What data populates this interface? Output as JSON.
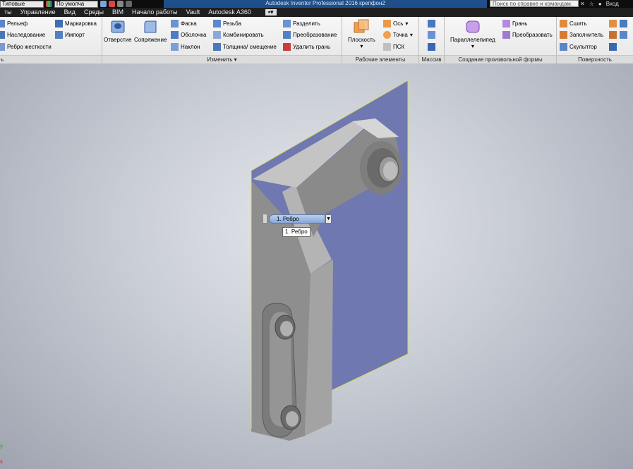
{
  "titlebar": {
    "style_select": "Типовые",
    "material_select": "По умолча",
    "app_title": "Autodesk Inventor Professional 2016    крепфон2",
    "search_placeholder": "Поиск по справке и командам.",
    "signin_label": "Вход"
  },
  "menubar": {
    "items": [
      {
        "label": "ты"
      },
      {
        "label": "Управление"
      },
      {
        "label": "Вид"
      },
      {
        "label": "Среды"
      },
      {
        "label": "BIM"
      },
      {
        "label": "Начало работы"
      },
      {
        "label": "Vault"
      },
      {
        "label": "Autodesk A360"
      }
    ]
  },
  "ribbon": {
    "create": {
      "relief": "Рельеф",
      "derive": "Наследование",
      "rib": "Ребро жесткости",
      "mark": "Маркировка",
      "import": "Импорт",
      "footer": "ь"
    },
    "modify": {
      "hole": "Отверстие",
      "fillet": "Сопряжение",
      "chamfer": "Фаска",
      "shell": "Оболочка",
      "draft": "Наклон",
      "thread": "Резьба",
      "combine": "Комбинировать",
      "thicken": "Толщина/ смещение",
      "split": "Разделить",
      "direct": "Преобразование",
      "delete_face": "Удалить грань",
      "footer": "Изменить ▾"
    },
    "work": {
      "plane": "Плоскость",
      "axis": "Ось",
      "point": "Точка",
      "ucs": "ПСК",
      "footer": "Рабочие элементы"
    },
    "pattern": {
      "footer": "Массив"
    },
    "freeform": {
      "box": "Параллелепипед",
      "face": "Грань",
      "convert": "Преобразовать",
      "footer": "Создание произвольной формы"
    },
    "surface": {
      "stitch": "Сшить",
      "patch": "Заполнитель",
      "sculpt": "Скульптор",
      "footer": "Поверхность"
    }
  },
  "viewport": {
    "selection_value": "1. Ребро",
    "tooltip": "1. Ребро",
    "axis_y": "y",
    "axis_x": "x"
  },
  "colors": {
    "accent_blue": "#1e4f8a",
    "sketch_plane": "#6a75b4",
    "part_gray": "#9a9a9a"
  }
}
